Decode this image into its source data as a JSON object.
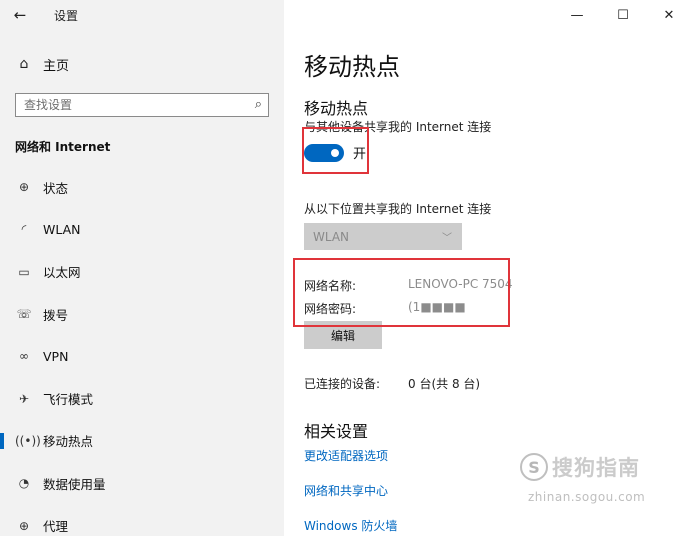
{
  "app": {
    "title": "设置"
  },
  "window": {
    "minimize_icon": "minimize-icon",
    "maximize_icon": "maximize-icon",
    "close_icon": "close-icon"
  },
  "sidebar": {
    "home_label": "主页",
    "search_placeholder": "查找设置",
    "section_title": "网络和 Internet",
    "items": [
      {
        "label": "状态",
        "icon": "globe-icon"
      },
      {
        "label": "WLAN",
        "icon": "wifi-icon"
      },
      {
        "label": "以太网",
        "icon": "ethernet-icon"
      },
      {
        "label": "拨号",
        "icon": "dialup-icon"
      },
      {
        "label": "VPN",
        "icon": "vpn-icon"
      },
      {
        "label": "飞行模式",
        "icon": "airplane-icon"
      },
      {
        "label": "移动热点",
        "icon": "hotspot-icon",
        "active": true
      },
      {
        "label": "数据使用量",
        "icon": "data-usage-icon"
      },
      {
        "label": "代理",
        "icon": "proxy-icon"
      }
    ]
  },
  "main": {
    "page_title": "移动热点",
    "hotspot_title": "移动热点",
    "share_desc": "与其他设备共享我的 Internet 连接",
    "toggle_label": "开",
    "toggle_on": true,
    "share_from_label": "从以下位置共享我的 Internet 连接",
    "share_from_value": "WLAN",
    "network_name_label": "网络名称:",
    "network_name_value": "LENOVO-PC 7504",
    "network_password_label": "网络密码:",
    "network_password_value": "(1■■■■",
    "edit_label": "编辑",
    "connected_label": "已连接的设备:",
    "connected_value": "0 台(共 8 台)",
    "related_title": "相关设置",
    "links": [
      "更改适配器选项",
      "网络和共享中心",
      "Windows 防火墙"
    ]
  },
  "watermark": {
    "text": "搜狗指南",
    "url": "zhinan.sogou.com"
  },
  "colors": {
    "accent": "#0067c0",
    "sidebar_bg": "#f2f2f2",
    "annotation": "#e0343a"
  }
}
